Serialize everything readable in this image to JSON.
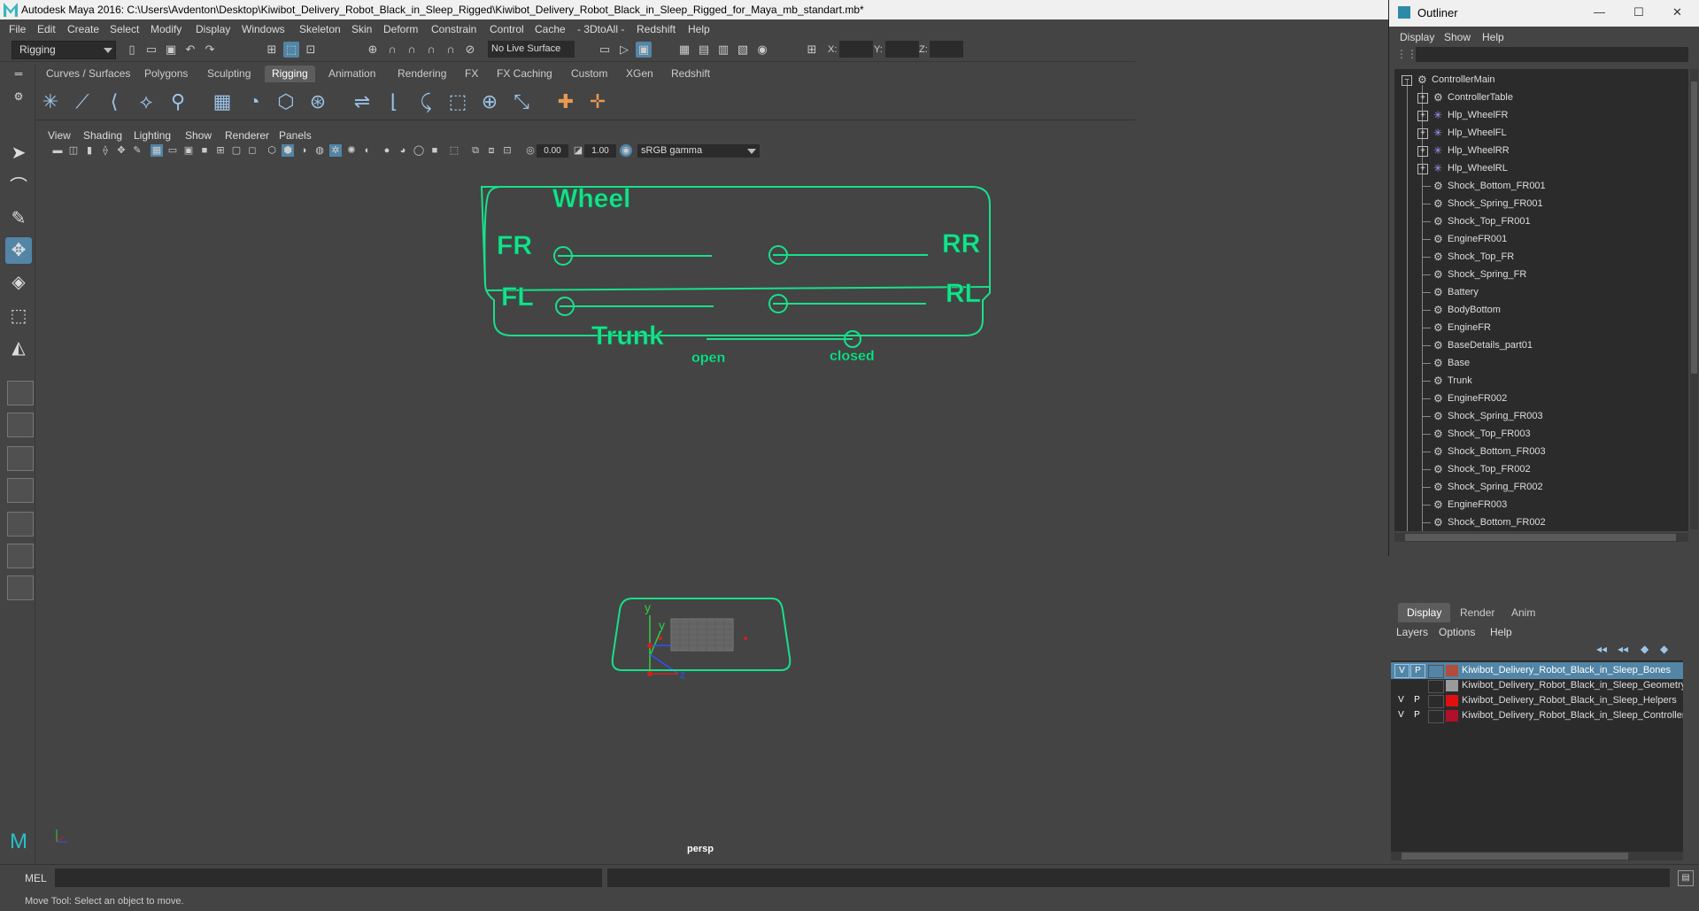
{
  "window": {
    "title": "Autodesk Maya 2016: C:\\Users\\Avdenton\\Desktop\\Kiwibot_Delivery_Robot_Black_in_Sleep_Rigged\\Kiwibot_Delivery_Robot_Black_in_Sleep_Rigged_for_Maya_mb_standart.mb*"
  },
  "menubar": [
    "File",
    "Edit",
    "Create",
    "Select",
    "Modify",
    "Display",
    "Windows",
    "Skeleton",
    "Skin",
    "Deform",
    "Constrain",
    "Control",
    "Cache",
    "- 3DtoAll -",
    "Redshift",
    "Help"
  ],
  "statusline": {
    "mode": "Rigging",
    "live_surface": "No Live Surface",
    "x_label": "X:",
    "y_label": "Y:",
    "z_label": "Z:"
  },
  "shelf_tabs": [
    "Curves / Surfaces",
    "Polygons",
    "Sculpting",
    "Rigging",
    "Animation",
    "Rendering",
    "FX",
    "FX Caching",
    "Custom",
    "XGen",
    "Redshift"
  ],
  "shelf_active": "Rigging",
  "viewport": {
    "menu": [
      "View",
      "Shading",
      "Lighting",
      "Show",
      "Renderer",
      "Panels"
    ],
    "exposure": "0.00",
    "gamma_value": "1.00",
    "color_space": "sRGB gamma",
    "camera_label": "persp",
    "control_panel": {
      "wheel_label": "Wheel",
      "fr": "FR",
      "fl": "FL",
      "rr": "RR",
      "rl": "RL",
      "trunk_label": "Trunk",
      "open_label": "open",
      "closed_label": "closed"
    },
    "accent_color": "#18e08a",
    "axis": {
      "y": "y",
      "z": "z"
    }
  },
  "cmdline": {
    "label": "MEL"
  },
  "helpline": {
    "text": "Move Tool: Select an object to move."
  },
  "outliner": {
    "title": "Outliner",
    "menu": [
      "Display",
      "Show",
      "Help"
    ],
    "items": [
      {
        "label": "ControllerMain",
        "kind": "root"
      },
      {
        "label": "ControllerTable",
        "kind": "group"
      },
      {
        "label": "Hlp_WheelFR",
        "kind": "joint"
      },
      {
        "label": "Hlp_WheelFL",
        "kind": "joint"
      },
      {
        "label": "Hlp_WheelRR",
        "kind": "joint"
      },
      {
        "label": "Hlp_WheelRL",
        "kind": "joint"
      },
      {
        "label": "Shock_Bottom_FR001",
        "kind": "mesh"
      },
      {
        "label": "Shock_Spring_FR001",
        "kind": "mesh"
      },
      {
        "label": "Shock_Top_FR001",
        "kind": "mesh"
      },
      {
        "label": "EngineFR001",
        "kind": "mesh"
      },
      {
        "label": "Shock_Top_FR",
        "kind": "mesh"
      },
      {
        "label": "Shock_Spring_FR",
        "kind": "mesh"
      },
      {
        "label": "Battery",
        "kind": "mesh"
      },
      {
        "label": "BodyBottom",
        "kind": "mesh"
      },
      {
        "label": "EngineFR",
        "kind": "mesh"
      },
      {
        "label": "BaseDetails_part01",
        "kind": "mesh"
      },
      {
        "label": "Base",
        "kind": "mesh"
      },
      {
        "label": "Trunk",
        "kind": "mesh"
      },
      {
        "label": "EngineFR002",
        "kind": "mesh"
      },
      {
        "label": "Shock_Spring_FR003",
        "kind": "mesh"
      },
      {
        "label": "Shock_Top_FR003",
        "kind": "mesh"
      },
      {
        "label": "Shock_Bottom_FR003",
        "kind": "mesh"
      },
      {
        "label": "Shock_Top_FR002",
        "kind": "mesh"
      },
      {
        "label": "Shock_Spring_FR002",
        "kind": "mesh"
      },
      {
        "label": "EngineFR003",
        "kind": "mesh"
      },
      {
        "label": "Shock_Bottom_FR002",
        "kind": "mesh"
      }
    ]
  },
  "layer_editor": {
    "tabs": [
      "Display",
      "Render",
      "Anim"
    ],
    "menu": [
      "Layers",
      "Options",
      "Help"
    ],
    "layers": [
      {
        "v": "V",
        "p": "P",
        "color": "#b24c3c",
        "label": "Kiwibot_Delivery_Robot_Black_in_Sleep_Bones",
        "selected": true
      },
      {
        "v": "",
        "p": "",
        "color": "#9a9a9a",
        "label": "Kiwibot_Delivery_Robot_Black_in_Sleep_Geometry",
        "selected": false
      },
      {
        "v": "V",
        "p": "P",
        "color": "#e01010",
        "label": "Kiwibot_Delivery_Robot_Black_in_Sleep_Helpers",
        "selected": false
      },
      {
        "v": "V",
        "p": "P",
        "color": "#b0102a",
        "label": "Kiwibot_Delivery_Robot_Black_in_Sleep_Controllers",
        "selected": false
      }
    ]
  }
}
